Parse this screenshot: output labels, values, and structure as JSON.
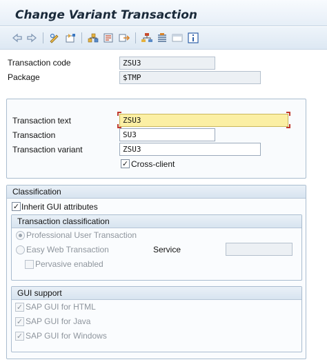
{
  "window": {
    "title": "Change Variant Transaction"
  },
  "toolbar": {
    "icons": [
      "back-arrow-icon",
      "forward-arrow-icon",
      "display-change-icon",
      "other-object-icon",
      "where-used-icon",
      "generate-icon",
      "export-icon",
      "hierarchy-icon",
      "bookmark-stack-icon",
      "window-icon",
      "info-icon"
    ]
  },
  "header": {
    "transaction_code_label": "Transaction code",
    "transaction_code_value": "ZSU3",
    "package_label": "Package",
    "package_value": "$TMP"
  },
  "main": {
    "transaction_text_label": "Transaction text",
    "transaction_text_value": "ZSU3",
    "transaction_label": "Transaction",
    "transaction_value": "SU3",
    "transaction_variant_label": "Transaction variant",
    "transaction_variant_value": "ZSU3",
    "cross_client_label": "Cross-client",
    "cross_client_checked": true
  },
  "classification": {
    "title": "Classification",
    "inherit_gui_label": "Inherit GUI attributes",
    "inherit_gui_checked": true,
    "transaction_classification": {
      "title": "Transaction classification",
      "professional_label": "Professional User Transaction",
      "easy_web_label": "Easy Web Transaction",
      "pervasive_label": "Pervasive enabled",
      "service_label": "Service",
      "service_value": "",
      "selected": "professional"
    },
    "gui_support": {
      "title": "GUI support",
      "html_label": "SAP GUI for HTML",
      "java_label": "SAP GUI for Java",
      "windows_label": "SAP GUI for Windows"
    }
  }
}
